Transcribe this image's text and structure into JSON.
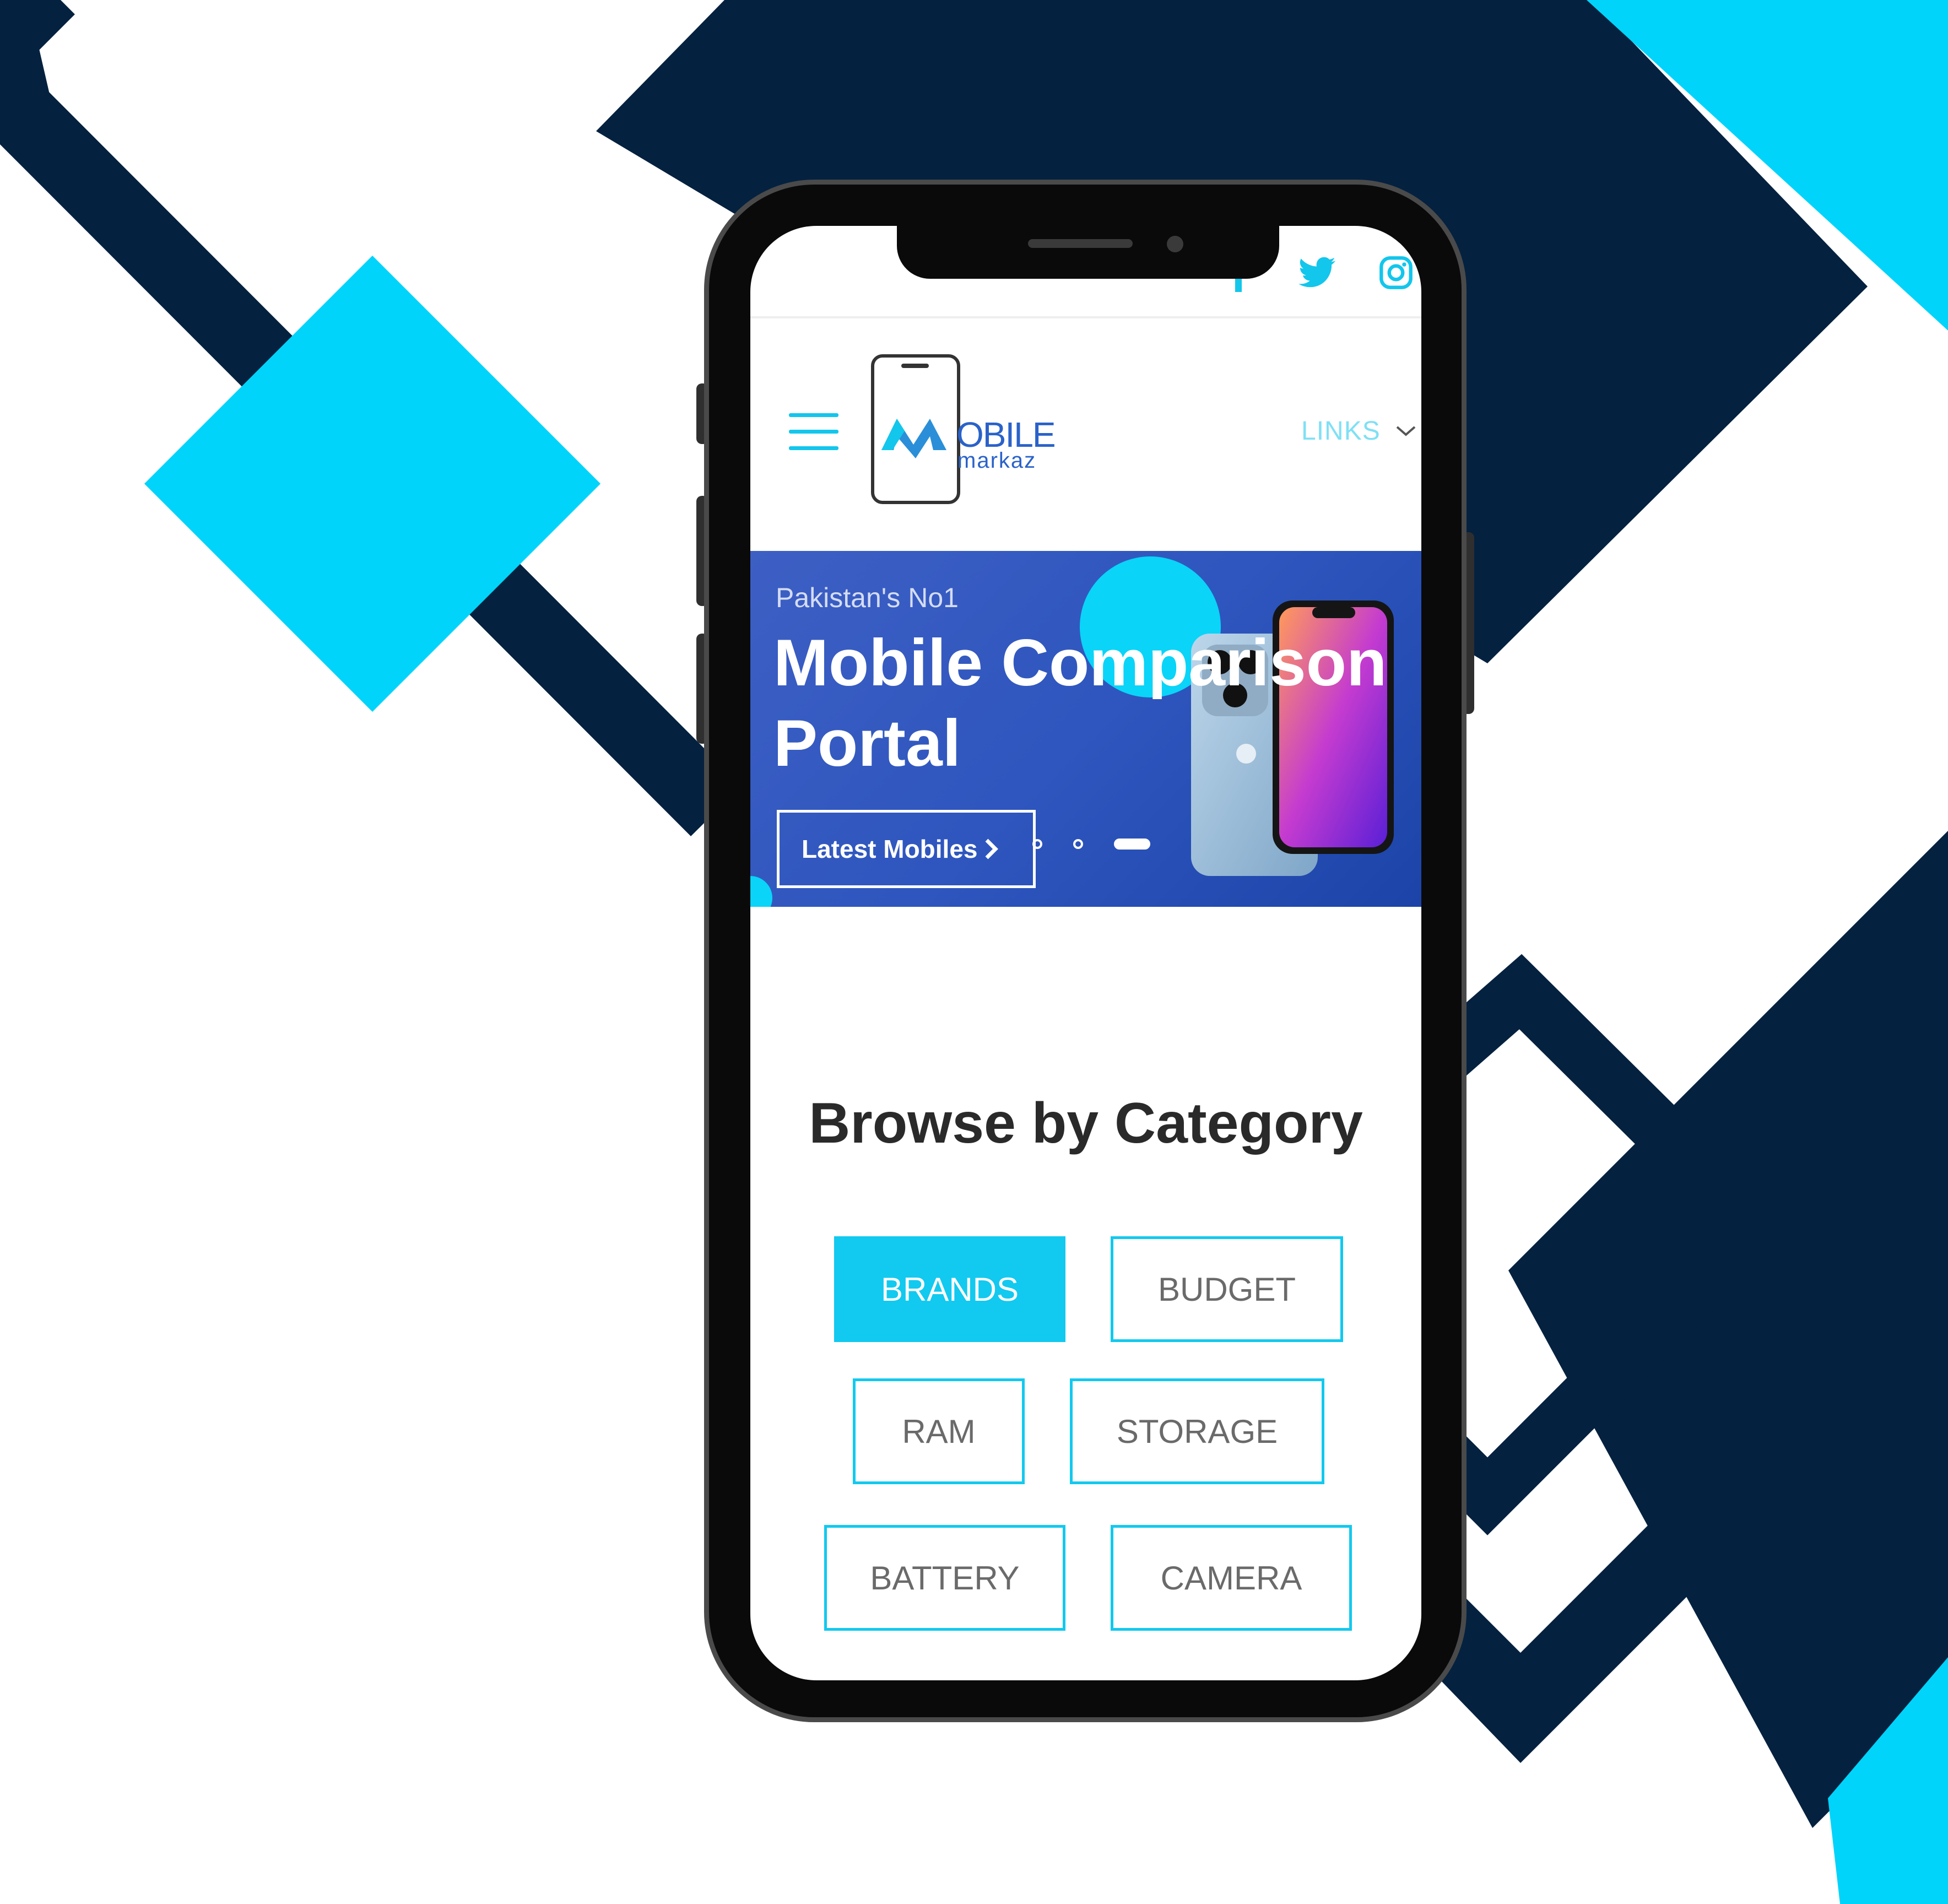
{
  "social": {
    "icons": [
      "facebook-icon",
      "twitter-icon",
      "instagram-icon"
    ]
  },
  "header": {
    "logo": {
      "word": "OBILE",
      "sub": "markaz"
    },
    "links_label": "LINKS"
  },
  "hero": {
    "subtitle": "Pakistan's No1",
    "title": "Mobile Comparison\nPortal",
    "button_label": "Latest Mobiles",
    "slides": {
      "count": 3,
      "active": 3
    }
  },
  "categories": {
    "title": "Browse by Category",
    "items": [
      {
        "label": "BRANDS",
        "active": true
      },
      {
        "label": "BUDGET",
        "active": false
      },
      {
        "label": "RAM",
        "active": false
      },
      {
        "label": "STORAGE",
        "active": false
      },
      {
        "label": "BATTERY",
        "active": false
      },
      {
        "label": "CAMERA",
        "active": false
      }
    ]
  },
  "colors": {
    "navy": "#04213f",
    "cyan": "#00d4fb",
    "accent": "#12c9ef",
    "hero_blue": "#2e56be"
  }
}
